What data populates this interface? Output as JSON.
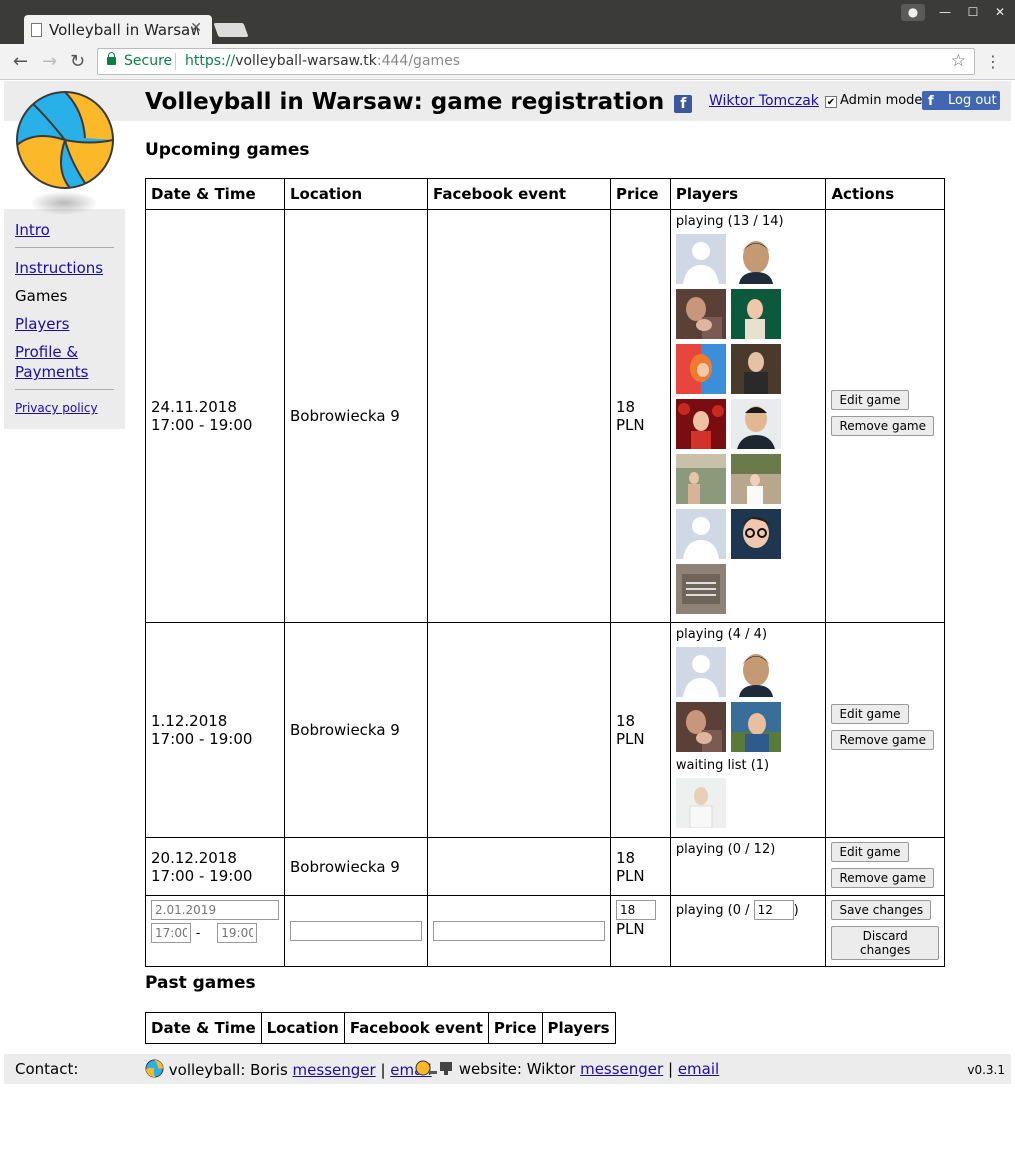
{
  "browser": {
    "tab_title": "Volleyball in Warsaw",
    "secure_label": "Secure",
    "url_scheme": "https://",
    "url_host": "volleyball-warsaw.tk",
    "url_port": ":444",
    "url_path": "/games"
  },
  "header": {
    "title": "Volleyball in Warsaw: game registration",
    "user_name": "Wiktor Tomczak",
    "admin_mode_label": "Admin mode",
    "admin_mode_checked": true,
    "logout_label": "Log out"
  },
  "sidebar": {
    "items": [
      {
        "label": "Intro",
        "active": false
      },
      {
        "label": "Instructions",
        "active": false
      },
      {
        "label": "Games",
        "active": true
      },
      {
        "label": "Players",
        "active": false
      },
      {
        "label": "Profile &",
        "active": false
      },
      {
        "label": "Payments",
        "active": false
      },
      {
        "label": "Privacy policy",
        "active": false
      }
    ]
  },
  "upcoming": {
    "title": "Upcoming games",
    "columns": [
      "Date & Time",
      "Location",
      "Facebook event",
      "Price",
      "Players",
      "Actions"
    ],
    "games": [
      {
        "date": "24.11.2018",
        "time": "17:00 - 19:00",
        "location": "Bobrowiecka 9",
        "price": "18 PLN",
        "playing_label": "playing (13 / 14)"
      },
      {
        "date": "1.12.2018",
        "time": "17:00 - 19:00",
        "location": "Bobrowiecka 9",
        "price": "18 PLN",
        "playing_label": "playing (4 / 4)",
        "waiting_label": "waiting list (1)"
      },
      {
        "date": "20.12.2018",
        "time": "17:00 - 19:00",
        "location": "Bobrowiecka 9",
        "price": "18 PLN",
        "playing_label": "playing (0 / 12)"
      }
    ],
    "edit_label": "Edit game",
    "remove_label": "Remove game",
    "new_game": {
      "date_placeholder": "2.01.2019",
      "start_placeholder": "17:00",
      "dash": "-",
      "end_placeholder": "19:00",
      "price_value": "18",
      "currency": "PLN",
      "playing_prefix": "playing (0 / ",
      "max_players_value": "12",
      "playing_suffix": ")",
      "save_label": "Save changes",
      "discard_label": "Discard changes"
    }
  },
  "past": {
    "title": "Past games",
    "columns": [
      "Date & Time",
      "Location",
      "Facebook event",
      "Price",
      "Players"
    ]
  },
  "footer": {
    "contact_label": "Contact:",
    "volleyball_prefix": "volleyball: Boris",
    "website_prefix": "website: Wiktor",
    "messenger_label": "messenger",
    "email_label": "email",
    "divider": "|",
    "version": "v0.3.1"
  }
}
